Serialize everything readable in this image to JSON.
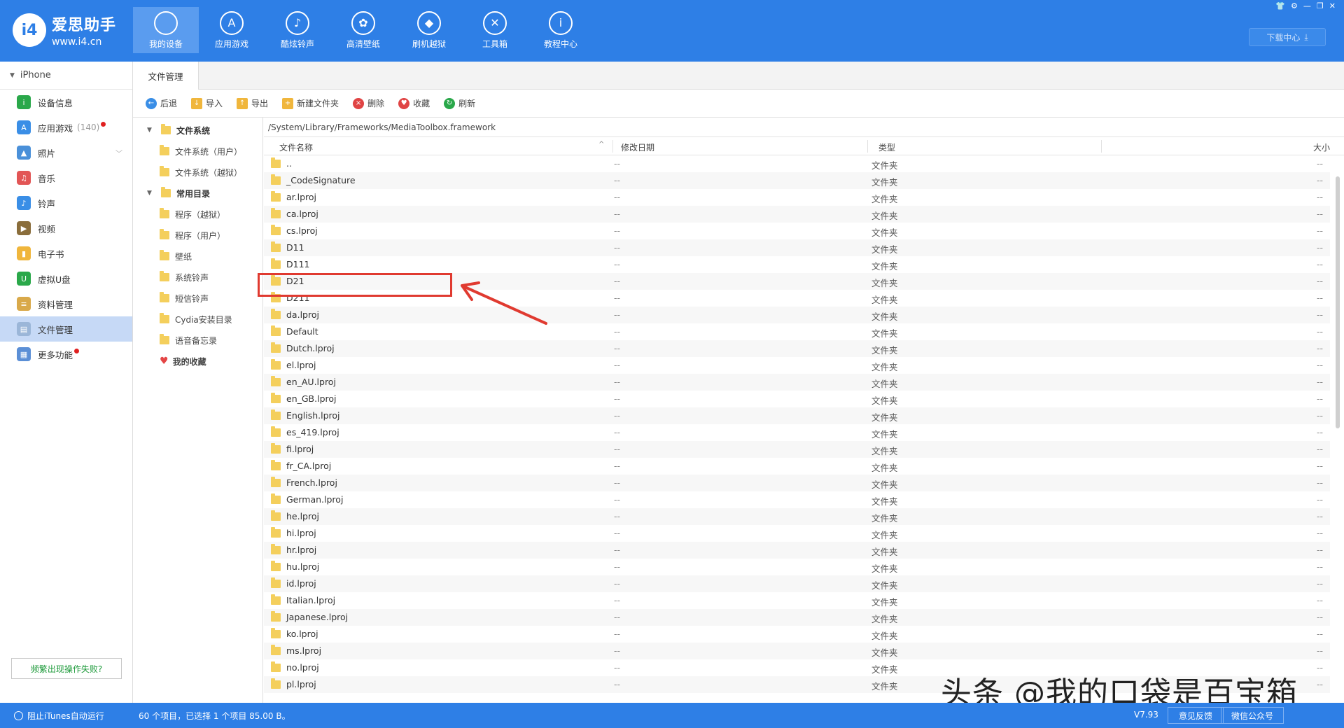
{
  "app": {
    "logo_badge": "i4",
    "name": "爱思助手",
    "url": "www.i4.cn",
    "download_center": "下载中心"
  },
  "nav": [
    {
      "label": "我的设备",
      "icon": "apple-icon",
      "glyph": "",
      "active": true
    },
    {
      "label": "应用游戏",
      "icon": "appstore-icon",
      "glyph": "A",
      "active": false
    },
    {
      "label": "酷炫铃声",
      "icon": "bell-icon",
      "glyph": "♪",
      "active": false
    },
    {
      "label": "高清壁纸",
      "icon": "flower-icon",
      "glyph": "✿",
      "active": false
    },
    {
      "label": "刷机越狱",
      "icon": "dropbox-icon",
      "glyph": "◆",
      "active": false
    },
    {
      "label": "工具箱",
      "icon": "tools-icon",
      "glyph": "✕",
      "active": false
    },
    {
      "label": "教程中心",
      "icon": "info-icon",
      "glyph": "i",
      "active": false
    }
  ],
  "sidebar": {
    "device": "iPhone",
    "items": [
      {
        "label": "设备信息",
        "icon": "info-icon",
        "color": "#2aa84a",
        "glyph": "i"
      },
      {
        "label": "应用游戏",
        "icon": "appstore-icon",
        "color": "#3a8ee6",
        "glyph": "A",
        "count": "(140)",
        "dot": true
      },
      {
        "label": "照片",
        "icon": "photo-icon",
        "color": "#4a90d9",
        "glyph": "▲",
        "chevron": true
      },
      {
        "label": "音乐",
        "icon": "music-icon",
        "color": "#e25555",
        "glyph": "♫"
      },
      {
        "label": "铃声",
        "icon": "bell-icon",
        "color": "#3a8ee6",
        "glyph": "♪"
      },
      {
        "label": "视频",
        "icon": "video-icon",
        "color": "#8a6d3b",
        "glyph": "▶"
      },
      {
        "label": "电子书",
        "icon": "book-icon",
        "color": "#f0b63c",
        "glyph": "▮"
      },
      {
        "label": "虚拟U盘",
        "icon": "usb-icon",
        "color": "#2aa84a",
        "glyph": "U"
      },
      {
        "label": "资料管理",
        "icon": "data-icon",
        "color": "#d9a94a",
        "glyph": "≡"
      },
      {
        "label": "文件管理",
        "icon": "file-icon",
        "color": "#9bb6d8",
        "glyph": "▤",
        "active": true
      },
      {
        "label": "更多功能",
        "icon": "grid-icon",
        "color": "#5b8fd6",
        "glyph": "▦",
        "dot": true
      }
    ],
    "help_button": "频繁出现操作失败?"
  },
  "tab": "文件管理",
  "toolbar": [
    {
      "label": "后退",
      "icon": "back-icon",
      "color": "#3a8ee6",
      "glyph": "←"
    },
    {
      "label": "导入",
      "icon": "import-icon",
      "color": "#f0b63c",
      "glyph": "↓",
      "sq": true
    },
    {
      "label": "导出",
      "icon": "export-icon",
      "color": "#f0b63c",
      "glyph": "↑",
      "sq": true
    },
    {
      "label": "新建文件夹",
      "icon": "new-folder-icon",
      "color": "#f0b63c",
      "glyph": "+",
      "sq": true
    },
    {
      "label": "删除",
      "icon": "delete-icon",
      "color": "#e04444",
      "glyph": "×"
    },
    {
      "label": "收藏",
      "icon": "heart-icon",
      "color": "#e04444",
      "glyph": "♥"
    },
    {
      "label": "刷新",
      "icon": "refresh-icon",
      "color": "#2aa84a",
      "glyph": "↻"
    }
  ],
  "tree": [
    {
      "label": "文件系统",
      "group": true
    },
    {
      "label": "文件系统（用户）"
    },
    {
      "label": "文件系统（越狱）"
    },
    {
      "label": "常用目录",
      "group": true
    },
    {
      "label": "程序（越狱）"
    },
    {
      "label": "程序（用户）"
    },
    {
      "label": "壁纸"
    },
    {
      "label": "系统铃声"
    },
    {
      "label": "短信铃声"
    },
    {
      "label": "Cydia安装目录"
    },
    {
      "label": "语音备忘录"
    },
    {
      "label": "我的收藏",
      "favorite": true
    }
  ],
  "path": "/System/Library/Frameworks/MediaToolbox.framework",
  "columns": {
    "name": "文件名称",
    "date": "修改日期",
    "type": "类型",
    "size": "大小"
  },
  "files": [
    {
      "name": "..",
      "date": "--",
      "type": "文件夹",
      "size": "--"
    },
    {
      "name": "_CodeSignature",
      "date": "--",
      "type": "文件夹",
      "size": "--"
    },
    {
      "name": "ar.lproj",
      "date": "--",
      "type": "文件夹",
      "size": "--"
    },
    {
      "name": "ca.lproj",
      "date": "--",
      "type": "文件夹",
      "size": "--"
    },
    {
      "name": "cs.lproj",
      "date": "--",
      "type": "文件夹",
      "size": "--"
    },
    {
      "name": "D11",
      "date": "--",
      "type": "文件夹",
      "size": "--"
    },
    {
      "name": "D111",
      "date": "--",
      "type": "文件夹",
      "size": "--"
    },
    {
      "name": "D21",
      "date": "--",
      "type": "文件夹",
      "size": "--"
    },
    {
      "name": "D211",
      "date": "--",
      "type": "文件夹",
      "size": "--"
    },
    {
      "name": "da.lproj",
      "date": "--",
      "type": "文件夹",
      "size": "--"
    },
    {
      "name": "Default",
      "date": "--",
      "type": "文件夹",
      "size": "--"
    },
    {
      "name": "Dutch.lproj",
      "date": "--",
      "type": "文件夹",
      "size": "--"
    },
    {
      "name": "el.lproj",
      "date": "--",
      "type": "文件夹",
      "size": "--"
    },
    {
      "name": "en_AU.lproj",
      "date": "--",
      "type": "文件夹",
      "size": "--"
    },
    {
      "name": "en_GB.lproj",
      "date": "--",
      "type": "文件夹",
      "size": "--"
    },
    {
      "name": "English.lproj",
      "date": "--",
      "type": "文件夹",
      "size": "--"
    },
    {
      "name": "es_419.lproj",
      "date": "--",
      "type": "文件夹",
      "size": "--"
    },
    {
      "name": "fi.lproj",
      "date": "--",
      "type": "文件夹",
      "size": "--"
    },
    {
      "name": "fr_CA.lproj",
      "date": "--",
      "type": "文件夹",
      "size": "--"
    },
    {
      "name": "French.lproj",
      "date": "--",
      "type": "文件夹",
      "size": "--"
    },
    {
      "name": "German.lproj",
      "date": "--",
      "type": "文件夹",
      "size": "--"
    },
    {
      "name": "he.lproj",
      "date": "--",
      "type": "文件夹",
      "size": "--"
    },
    {
      "name": "hi.lproj",
      "date": "--",
      "type": "文件夹",
      "size": "--"
    },
    {
      "name": "hr.lproj",
      "date": "--",
      "type": "文件夹",
      "size": "--"
    },
    {
      "name": "hu.lproj",
      "date": "--",
      "type": "文件夹",
      "size": "--"
    },
    {
      "name": "id.lproj",
      "date": "--",
      "type": "文件夹",
      "size": "--"
    },
    {
      "name": "Italian.lproj",
      "date": "--",
      "type": "文件夹",
      "size": "--"
    },
    {
      "name": "Japanese.lproj",
      "date": "--",
      "type": "文件夹",
      "size": "--"
    },
    {
      "name": "ko.lproj",
      "date": "--",
      "type": "文件夹",
      "size": "--"
    },
    {
      "name": "ms.lproj",
      "date": "--",
      "type": "文件夹",
      "size": "--"
    },
    {
      "name": "no.lproj",
      "date": "--",
      "type": "文件夹",
      "size": "--"
    },
    {
      "name": "pl.lproj",
      "date": "--",
      "type": "文件夹",
      "size": "--"
    }
  ],
  "status": {
    "itunes": "阻止iTunes自动运行",
    "info": "60 个项目，已选择 1 个项目 85.00 B。",
    "version": "V7.93",
    "feedback": "意见反馈",
    "wechat": "微信公众号"
  },
  "watermark": "头条 @我的口袋是百宝箱",
  "colors": {
    "brand": "#2e7fe6",
    "highlight": "#e03a30",
    "folder": "#f4cf5c"
  }
}
